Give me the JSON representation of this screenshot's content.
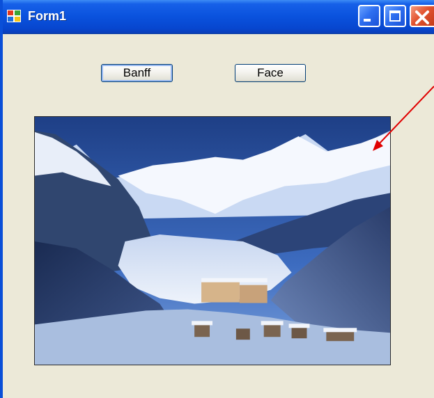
{
  "window": {
    "title": "Form1"
  },
  "buttons": {
    "banff_label": "Banff",
    "face_label": "Face"
  },
  "picture_box": {
    "image": "snowy-mountain-lake-landscape"
  },
  "icons": {
    "app": "windows-form-icon",
    "minimize": "minimize-icon",
    "maximize": "maximize-icon",
    "close": "close-icon"
  },
  "colors": {
    "titlebar": "#0a52dd",
    "form_background": "#ece9d8",
    "close_button": "#e2532f",
    "annotation_arrow": "#e00000"
  }
}
